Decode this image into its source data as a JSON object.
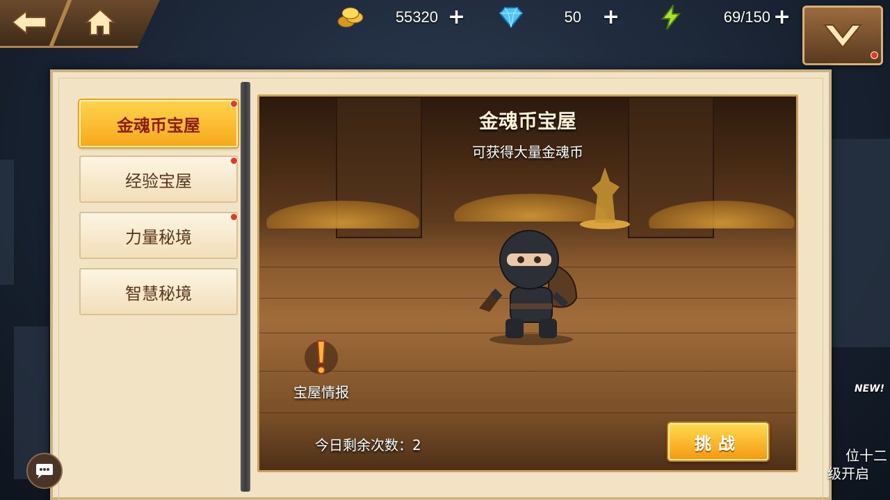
{
  "resources": {
    "gold": "55320",
    "diamond": "50",
    "energy": "69/150"
  },
  "sidebar": {
    "items": [
      {
        "label": "金魂币宝屋"
      },
      {
        "label": "经验宝屋"
      },
      {
        "label": "力量秘境"
      },
      {
        "label": "智慧秘境"
      }
    ]
  },
  "scene": {
    "title": "金魂币宝屋",
    "subtitle": "可获得大量金魂币",
    "intel_label": "宝屋情报",
    "remaining": "今日剩余次数：2",
    "challenge_label": "挑战"
  },
  "edge_event": {
    "badge": "NEW!",
    "line1": "位十二",
    "line2": "级开启"
  },
  "colors": {
    "accent": "#f7a81b",
    "panel": "#f1e3c4",
    "active_text": "#8a1f0a"
  }
}
